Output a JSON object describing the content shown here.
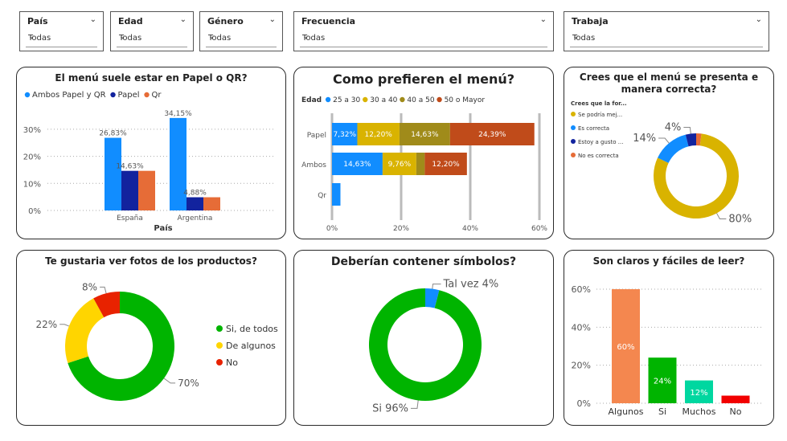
{
  "slicers": [
    {
      "title": "País",
      "value": "Todas"
    },
    {
      "title": "Edad",
      "value": "Todas"
    },
    {
      "title": "Género",
      "value": "Todas"
    },
    {
      "title": "Frecuencia",
      "value": "Todas"
    },
    {
      "title": "Trabaja",
      "value": "Todas"
    }
  ],
  "colors": {
    "blue": "#118DFF",
    "navy": "#12239E",
    "orange": "#E66C37",
    "gold": "#D9B300",
    "olive": "#A08B1A",
    "rust": "#C04B1A",
    "green1": "#00B400",
    "yellow": "#FFD500",
    "red": "#E82200",
    "sage": "#00C200",
    "salmon": "#F4874F",
    "teal": "#00D7A0",
    "redbar": "#F20000"
  },
  "chart_data": [
    {
      "type": "bar",
      "title": "El menú suele estar en Papel o QR?",
      "xlabel": "País",
      "categories": [
        "España",
        "Argentina"
      ],
      "legend": [
        "Ambos Papel y QR",
        "Papel",
        "Qr"
      ],
      "series": [
        {
          "name": "Ambos Papel y QR",
          "values": [
            26.83,
            34.15
          ],
          "labels": [
            "26,83%",
            "34,15%"
          ]
        },
        {
          "name": "Papel",
          "values": [
            14.63,
            4.88
          ],
          "labels": [
            "14,63%",
            "4,88%"
          ]
        },
        {
          "name": "Qr",
          "values": [
            14.63,
            4.88
          ],
          "labels": [
            "",
            ""
          ]
        }
      ],
      "ylim": [
        0,
        35
      ],
      "yticks": [
        "0%",
        "10%",
        "20%",
        "30%"
      ]
    },
    {
      "type": "bar",
      "orientation": "horizontal-stacked",
      "title": "Como prefieren el menú?",
      "legend_title": "Edad",
      "legend": [
        "25 a 30",
        "30 a 40",
        "40 a 50",
        "50 o Mayor"
      ],
      "categories": [
        "Papel",
        "Ambos",
        "Qr"
      ],
      "series": [
        {
          "name": "25 a 30",
          "values": [
            7.32,
            14.63,
            2.44
          ],
          "labels": [
            "7,32%",
            "14,63%",
            ""
          ]
        },
        {
          "name": "30 a 40",
          "values": [
            12.2,
            9.76,
            0
          ],
          "labels": [
            "12,20%",
            "9,76%",
            ""
          ]
        },
        {
          "name": "40 a 50",
          "values": [
            14.63,
            2.44,
            0
          ],
          "labels": [
            "14,63%",
            "",
            ""
          ]
        },
        {
          "name": "50 o Mayor",
          "values": [
            24.39,
            12.2,
            0
          ],
          "labels": [
            "24,39%",
            "12,20%",
            ""
          ]
        }
      ],
      "xlim": [
        0,
        60
      ],
      "xticks": [
        "0%",
        "20%",
        "40%",
        "60%"
      ]
    },
    {
      "type": "pie",
      "title": "Crees que el menú se presenta e manera correcta?",
      "legend_title": "Crees que la for...",
      "legend": [
        "Se podría mej...",
        "Es correcta",
        "Estoy a gusto ...",
        "No es correcta"
      ],
      "values": [
        80,
        14,
        4,
        2
      ],
      "labels": [
        "80%",
        "14%",
        "4%",
        ""
      ]
    },
    {
      "type": "pie",
      "title": "Te gustaria ver fotos de los productos?",
      "legend": [
        "Si, de todos",
        "De algunos",
        "No"
      ],
      "values": [
        70,
        22,
        8
      ],
      "labels": [
        "70%",
        "22%",
        "8%"
      ]
    },
    {
      "type": "pie",
      "title": "Deberían contener símbolos?",
      "values": [
        96,
        4
      ],
      "labels": [
        "Si 96%",
        "Tal vez 4%"
      ]
    },
    {
      "type": "bar",
      "title": "Son claros y fáciles de leer?",
      "categories": [
        "Algunos",
        "Si",
        "Muchos",
        "No"
      ],
      "values": [
        60,
        24,
        12,
        4
      ],
      "labels": [
        "60%",
        "24%",
        "12%",
        ""
      ],
      "ylim": [
        0,
        60
      ],
      "yticks": [
        "0%",
        "20%",
        "40%",
        "60%"
      ]
    }
  ]
}
